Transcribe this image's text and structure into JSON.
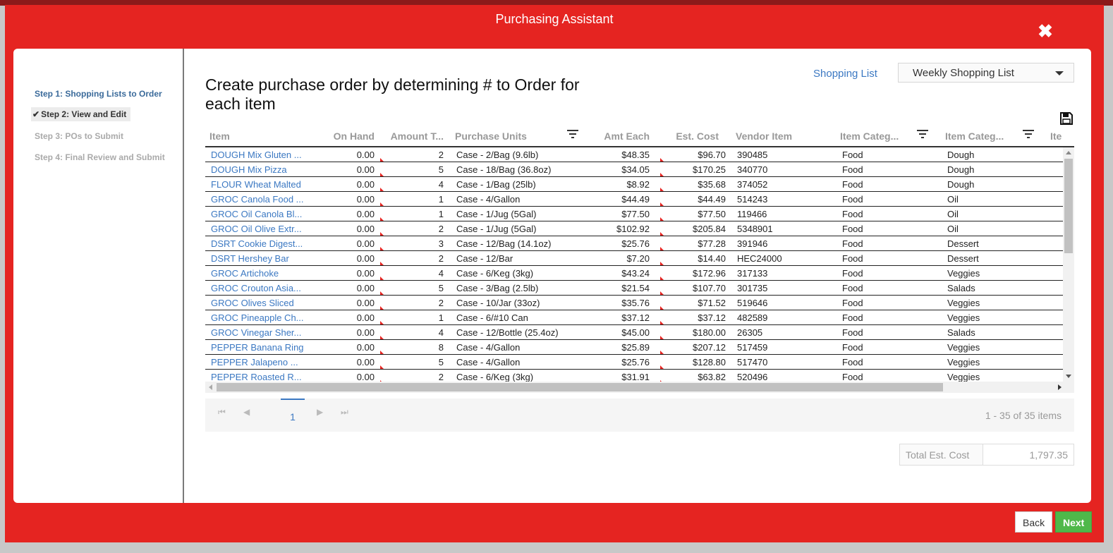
{
  "modal": {
    "title": "Purchasing Assistant"
  },
  "steps": [
    {
      "label": "Step 1: Shopping Lists to Order",
      "state": "done"
    },
    {
      "label": "Step 2: View and Edit",
      "state": "current"
    },
    {
      "label": "Step 3: POs to Submit",
      "state": "pending"
    },
    {
      "label": "Step 4: Final Review and Submit",
      "state": "pending"
    }
  ],
  "main": {
    "heading": "Create purchase order by determining # to Order for each item",
    "shopping_list_label": "Shopping List",
    "shopping_list_value": "Weekly Shopping List"
  },
  "columns": [
    "Item",
    "On Hand",
    "Amount T...",
    "Purchase Units",
    "Amt Each",
    "Est. Cost",
    "Vendor Item",
    "Item Categ...",
    "Item Categ...",
    "Ite"
  ],
  "rows": [
    [
      "DOUGH Mix Gluten ...",
      "0.00",
      "2",
      "Case - 2/Bag (9.6lb)",
      "$48.35",
      "$96.70",
      "390485",
      "Food",
      "Dough"
    ],
    [
      "DOUGH Mix Pizza",
      "0.00",
      "5",
      "Case - 18/Bag (36.8oz)",
      "$34.05",
      "$170.25",
      "340770",
      "Food",
      "Dough"
    ],
    [
      "FLOUR Wheat Malted",
      "0.00",
      "4",
      "Case - 1/Bag (25lb)",
      "$8.92",
      "$35.68",
      "374052",
      "Food",
      "Dough"
    ],
    [
      "GROC Canola Food ...",
      "0.00",
      "1",
      "Case - 4/Gallon",
      "$44.49",
      "$44.49",
      "514243",
      "Food",
      "Oil"
    ],
    [
      "GROC Oil Canola Bl...",
      "0.00",
      "1",
      "Case - 1/Jug (5Gal)",
      "$77.50",
      "$77.50",
      "119466",
      "Food",
      "Oil"
    ],
    [
      "GROC Oil Olive Extr...",
      "0.00",
      "2",
      "Case - 1/Jug (5Gal)",
      "$102.92",
      "$205.84",
      "5348901",
      "Food",
      "Oil"
    ],
    [
      "DSRT Cookie Digest...",
      "0.00",
      "3",
      "Case - 12/Bag (14.1oz)",
      "$25.76",
      "$77.28",
      "391946",
      "Food",
      "Dessert"
    ],
    [
      "DSRT Hershey Bar",
      "0.00",
      "2",
      "Case - 12/Bar",
      "$7.20",
      "$14.40",
      "HEC24000",
      "Food",
      "Dessert"
    ],
    [
      "GROC Artichoke",
      "0.00",
      "4",
      "Case - 6/Keg (3kg)",
      "$43.24",
      "$172.96",
      "317133",
      "Food",
      "Veggies"
    ],
    [
      "GROC Crouton Asia...",
      "0.00",
      "5",
      "Case - 3/Bag (2.5lb)",
      "$21.54",
      "$107.70",
      "301735",
      "Food",
      "Salads"
    ],
    [
      "GROC Olives Sliced",
      "0.00",
      "2",
      "Case - 10/Jar (33oz)",
      "$35.76",
      "$71.52",
      "519646",
      "Food",
      "Veggies"
    ],
    [
      "GROC Pineapple Ch...",
      "0.00",
      "1",
      "Case - 6/#10 Can",
      "$37.12",
      "$37.12",
      "482589",
      "Food",
      "Veggies"
    ],
    [
      "GROC Vinegar Sher...",
      "0.00",
      "4",
      "Case - 12/Bottle (25.4oz)",
      "$45.00",
      "$180.00",
      "26305",
      "Food",
      "Salads"
    ],
    [
      "PEPPER Banana Ring",
      "0.00",
      "8",
      "Case - 4/Gallon",
      "$25.89",
      "$207.12",
      "517459",
      "Food",
      "Veggies"
    ],
    [
      "PEPPER Jalapeno ...",
      "0.00",
      "5",
      "Case - 4/Gallon",
      "$25.76",
      "$128.80",
      "517470",
      "Food",
      "Veggies"
    ],
    [
      "PEPPER Roasted R...",
      "0.00",
      "2",
      "Case - 6/Keg (3kg)",
      "$31.91",
      "$63.82",
      "520496",
      "Food",
      "Veggies"
    ]
  ],
  "pager": {
    "page": "1",
    "info": "1 - 35 of 35 items"
  },
  "total": {
    "label": "Total Est. Cost",
    "value": "1,797.35"
  },
  "footer": {
    "back": "Back",
    "next": "Next"
  },
  "icons": {
    "close": "close-icon",
    "save": "save-icon",
    "filter": "filter-icon",
    "check": "check-icon"
  },
  "colors": {
    "brand": "#e52421",
    "link": "#3b78c2",
    "next": "#4fb84a"
  }
}
